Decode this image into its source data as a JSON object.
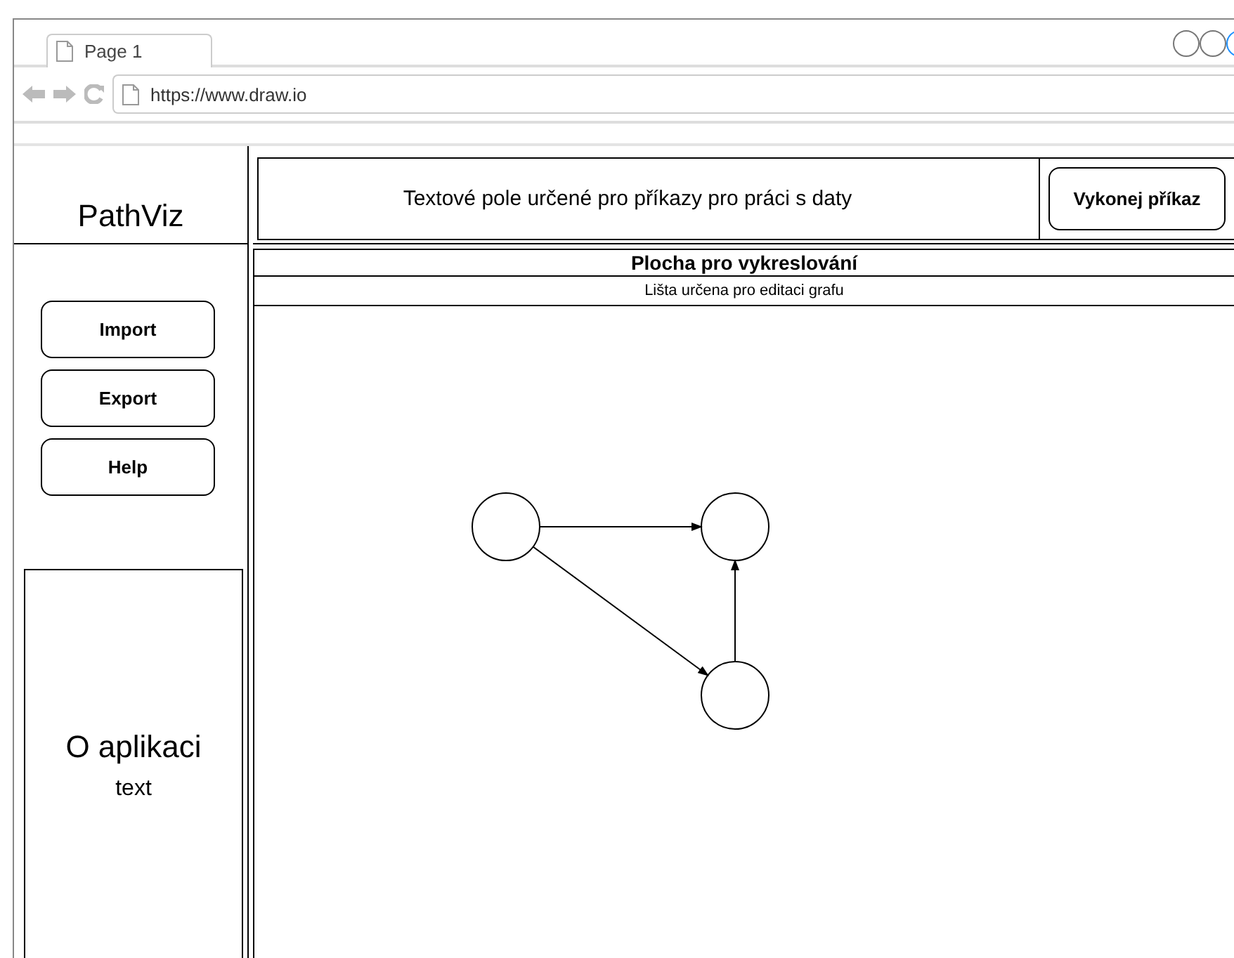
{
  "browser": {
    "tab": "Page 1",
    "url": "https://www.draw.io"
  },
  "app": {
    "logo": "PathViz",
    "command_field": {
      "text": "Textové pole určené pro příkazy pro práci s daty"
    },
    "command_button": "Vykonej příkaz",
    "sidebar": {
      "buttons": [
        "Import",
        "Export",
        "Help"
      ],
      "about": {
        "title": "O aplikaci",
        "text": "text"
      }
    },
    "canvas": {
      "title": "Plocha pro vykreslování",
      "toolbar": "Lišta určena pro editaci grafu",
      "graph": {
        "nodes": [
          {
            "kind": "circle"
          },
          {
            "kind": "circle"
          },
          {
            "kind": "circle"
          }
        ],
        "edges": [
          {
            "kind": "arrow"
          },
          {
            "kind": "arrow"
          },
          {
            "kind": "arrow"
          }
        ]
      }
    }
  }
}
